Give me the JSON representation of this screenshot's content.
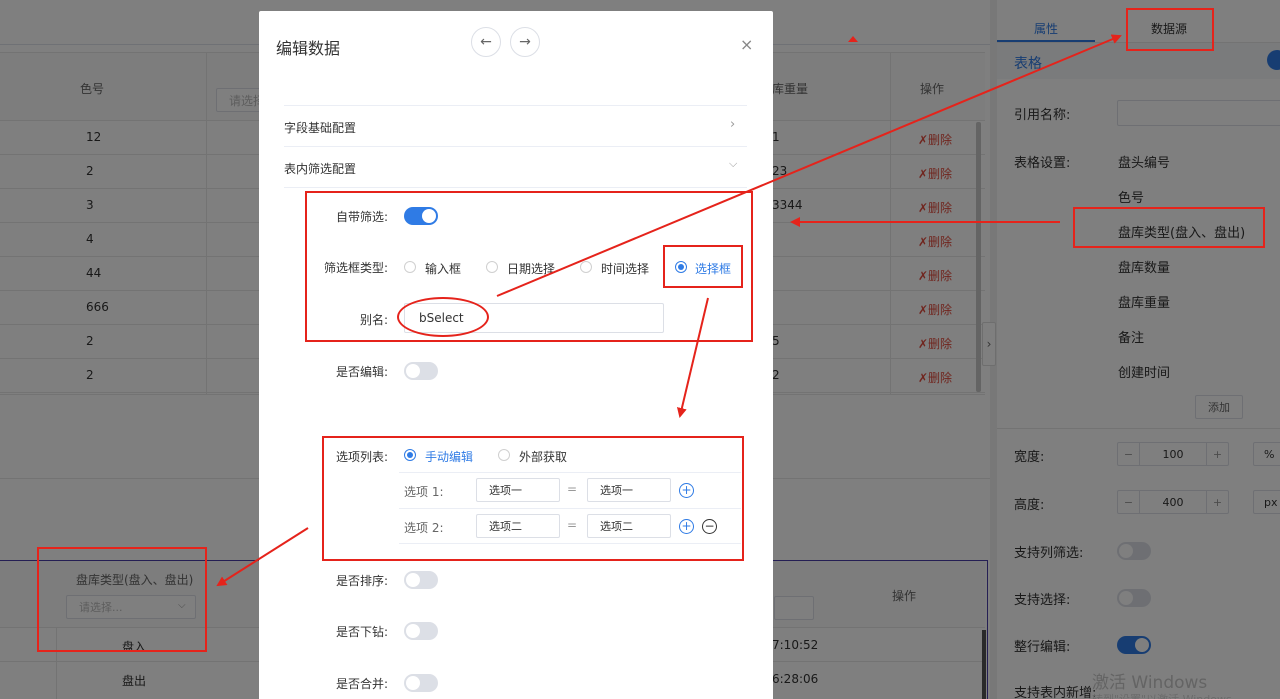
{
  "table": {
    "header": {
      "color": "色号",
      "select_placeholder": "请选择",
      "weight": "库重量",
      "op": "操作"
    },
    "rows": [
      {
        "color": "12",
        "weight": "1",
        "op": "✗删除"
      },
      {
        "color": "2",
        "weight": "23",
        "op": "✗删除"
      },
      {
        "color": "3",
        "weight": "3344",
        "op": "✗删除"
      },
      {
        "color": "4",
        "weight": "",
        "op": "✗删除"
      },
      {
        "color": "44",
        "weight": "",
        "op": "✗删除"
      },
      {
        "color": "666",
        "weight": "",
        "op": "✗删除"
      },
      {
        "color": "2",
        "weight": "5",
        "op": "✗删除"
      },
      {
        "color": "2",
        "weight": "2",
        "op": "✗删除"
      }
    ]
  },
  "preview": {
    "header": "盘库类型(盘入、盘出)",
    "placeholder": "请选择...",
    "op": "操作",
    "rows": [
      {
        "type": "盘入",
        "time": "7:10:52"
      },
      {
        "type": "盘出",
        "time": "6:28:06"
      }
    ]
  },
  "dialog": {
    "title": "编辑数据",
    "section_basic": "字段基础配置",
    "section_filter": "表内筛选配置",
    "filter_toggle_label": "自带筛选:",
    "filter_type_label": "筛选框类型:",
    "filter_types": [
      "输入框",
      "日期选择",
      "时间选择",
      "选择框"
    ],
    "alias_label": "别名:",
    "alias_value": "bSelect",
    "editable_label": "是否编辑:",
    "options_label": "选项列表:",
    "options_modes": [
      "手动编辑",
      "外部获取"
    ],
    "options": [
      {
        "label": "选项 1:",
        "key": "选项一",
        "value": "选项一"
      },
      {
        "label": "选项 2:",
        "key": "选项二",
        "value": "选项二"
      }
    ],
    "eq": "=",
    "sort_label": "是否排序:",
    "drill_label": "是否下钻:",
    "merge_label": "是否合并:"
  },
  "panel": {
    "tabs": [
      "属性",
      "数据源"
    ],
    "section": "表格",
    "ref_label": "引用名称:",
    "table_settings_label": "表格设置:",
    "fields": [
      "盘头编号",
      "色号",
      "盘库类型(盘入、盘出)",
      "盘库数量",
      "盘库重量",
      "备注",
      "创建时间"
    ],
    "add": "添加",
    "width_label": "宽度:",
    "width_value": "100",
    "width_unit": "%",
    "height_label": "高度:",
    "height_value": "400",
    "height_unit": "px",
    "minus": "−",
    "plus": "+",
    "col_filter_label": "支持列筛选:",
    "select_label": "支持选择:",
    "row_edit_label": "整行编辑:",
    "add_in_table_label": "支持表内新增:"
  },
  "watermark": {
    "line1": "激活 Windows",
    "line2": "转到\"设置\"以激活 Windows。"
  }
}
